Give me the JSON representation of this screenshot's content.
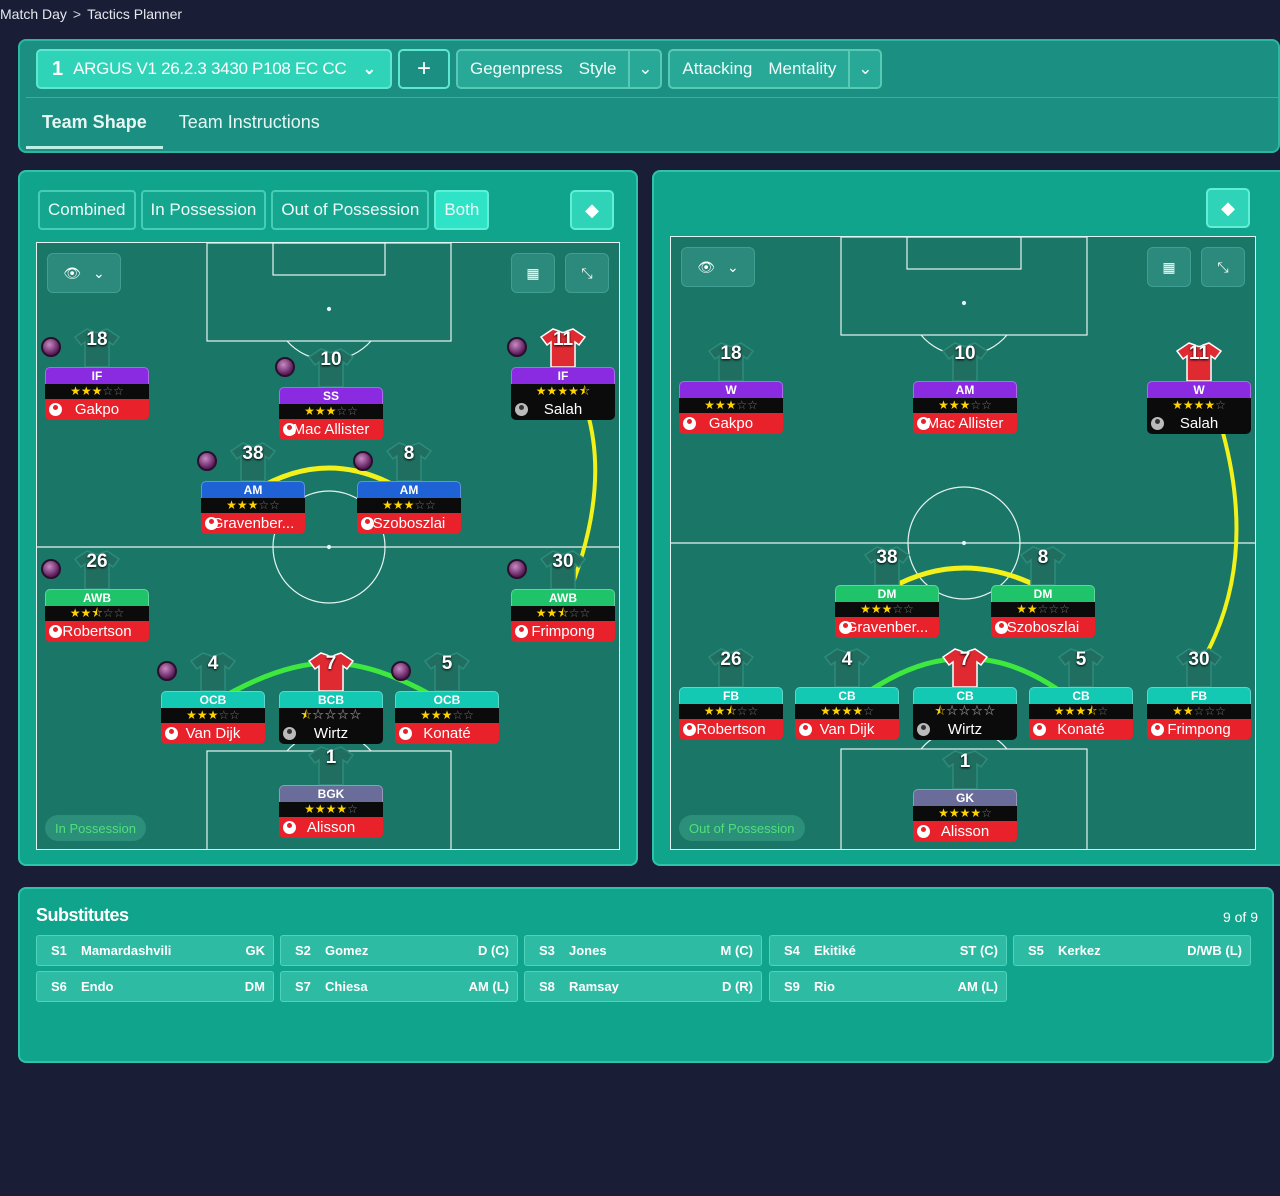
{
  "breadcrumb": {
    "root": "Match Day",
    "separator": ">",
    "current": "Tactics Planner"
  },
  "header": {
    "tactic_number": "1",
    "tactic_name": "ARGUS V1 26.2.3 3430 P108 EC CC",
    "add_label": "+",
    "style_value": "Gegenpress",
    "style_label": "Style",
    "mentality_value": "Attacking",
    "mentality_label": "Mentality",
    "tabs": [
      "Team Shape",
      "Team Instructions"
    ]
  },
  "phase_buttons": [
    "Combined",
    "In Possession",
    "Out of Possession",
    "Both"
  ],
  "selected_phase": "Both",
  "pitch_left": {
    "phase_badge": "In Possession",
    "players": [
      {
        "no": "18",
        "pos": "IF",
        "name": "Gakpo",
        "stars": 3,
        "ball": true,
        "posColor": "purple",
        "nameColor": "red"
      },
      {
        "no": "10",
        "pos": "SS",
        "name": "Mac Allister",
        "stars": 3,
        "ball": true,
        "posColor": "purple",
        "nameColor": "red"
      },
      {
        "no": "11",
        "pos": "IF",
        "name": "Salah",
        "stars": 4.5,
        "ball": true,
        "posColor": "purple",
        "nameColor": "black",
        "kit": "red"
      },
      {
        "no": "38",
        "pos": "AM",
        "name": "Gravenber...",
        "stars": 3,
        "ball": true,
        "posColor": "blue",
        "nameColor": "red"
      },
      {
        "no": "8",
        "pos": "AM",
        "name": "Szoboszlai",
        "stars": 3,
        "ball": true,
        "posColor": "blue",
        "nameColor": "red"
      },
      {
        "no": "26",
        "pos": "AWB",
        "name": "Robertson",
        "stars": 2.5,
        "ball": true,
        "posColor": "green",
        "nameColor": "red"
      },
      {
        "no": "30",
        "pos": "AWB",
        "name": "Frimpong",
        "stars": 2.5,
        "ball": true,
        "posColor": "green",
        "nameColor": "red"
      },
      {
        "no": "4",
        "pos": "OCB",
        "name": "Van Dijk",
        "stars": 3,
        "ball": true,
        "posColor": "teal",
        "nameColor": "red"
      },
      {
        "no": "7",
        "pos": "BCB",
        "name": "Wirtz",
        "stars": 0.5,
        "ball": false,
        "posColor": "teal",
        "nameColor": "black",
        "kit": "red"
      },
      {
        "no": "5",
        "pos": "OCB",
        "name": "Konaté",
        "stars": 3,
        "ball": true,
        "posColor": "teal",
        "nameColor": "red"
      },
      {
        "no": "1",
        "pos": "BGK",
        "name": "Alisson",
        "stars": 4,
        "ball": false,
        "posColor": "grey",
        "nameColor": "red"
      }
    ]
  },
  "pitch_right": {
    "phase_badge": "Out of Possession",
    "players": [
      {
        "no": "18",
        "pos": "W",
        "name": "Gakpo",
        "stars": 3,
        "posColor": "purple",
        "nameColor": "red"
      },
      {
        "no": "10",
        "pos": "AM",
        "name": "Mac Allister",
        "stars": 3,
        "posColor": "purple",
        "nameColor": "red"
      },
      {
        "no": "11",
        "pos": "W",
        "name": "Salah",
        "stars": 4,
        "posColor": "purple",
        "nameColor": "black",
        "kit": "red"
      },
      {
        "no": "38",
        "pos": "DM",
        "name": "Gravenber...",
        "stars": 3,
        "posColor": "green",
        "nameColor": "red"
      },
      {
        "no": "8",
        "pos": "DM",
        "name": "Szoboszlai",
        "stars": 2,
        "posColor": "green",
        "nameColor": "red"
      },
      {
        "no": "26",
        "pos": "FB",
        "name": "Robertson",
        "stars": 2.5,
        "posColor": "teal",
        "nameColor": "red"
      },
      {
        "no": "4",
        "pos": "CB",
        "name": "Van Dijk",
        "stars": 4,
        "posColor": "teal",
        "nameColor": "red"
      },
      {
        "no": "7",
        "pos": "CB",
        "name": "Wirtz",
        "stars": 0.5,
        "posColor": "teal",
        "nameColor": "black",
        "kit": "red"
      },
      {
        "no": "5",
        "pos": "CB",
        "name": "Konaté",
        "stars": 3.5,
        "posColor": "teal",
        "nameColor": "red"
      },
      {
        "no": "30",
        "pos": "FB",
        "name": "Frimpong",
        "stars": 2,
        "posColor": "teal",
        "nameColor": "red"
      },
      {
        "no": "1",
        "pos": "GK",
        "name": "Alisson",
        "stars": 4,
        "posColor": "grey",
        "nameColor": "red"
      }
    ]
  },
  "substitutes": {
    "title": "Substitutes",
    "count": "9 of 9",
    "items": [
      {
        "slot": "S1",
        "name": "Mamardashvili",
        "pos": "GK"
      },
      {
        "slot": "S2",
        "name": "Gomez",
        "pos": "D (C)"
      },
      {
        "slot": "S3",
        "name": "Jones",
        "pos": "M (C)"
      },
      {
        "slot": "S4",
        "name": "Ekitiké",
        "pos": "ST (C)"
      },
      {
        "slot": "S5",
        "name": "Kerkez",
        "pos": "D/WB (L)"
      },
      {
        "slot": "S6",
        "name": "Endo",
        "pos": "DM"
      },
      {
        "slot": "S7",
        "name": "Chiesa",
        "pos": "AM (L)"
      },
      {
        "slot": "S8",
        "name": "Ramsay",
        "pos": "D (R)"
      },
      {
        "slot": "S9",
        "name": "Rio",
        "pos": "AM (L)"
      }
    ]
  },
  "colors": {
    "accent": "#2fd3b8",
    "panel": "#0fa48b",
    "pitch": "#1a7667",
    "link_yellow": "#f2f21a",
    "link_green": "#3ee83e"
  }
}
